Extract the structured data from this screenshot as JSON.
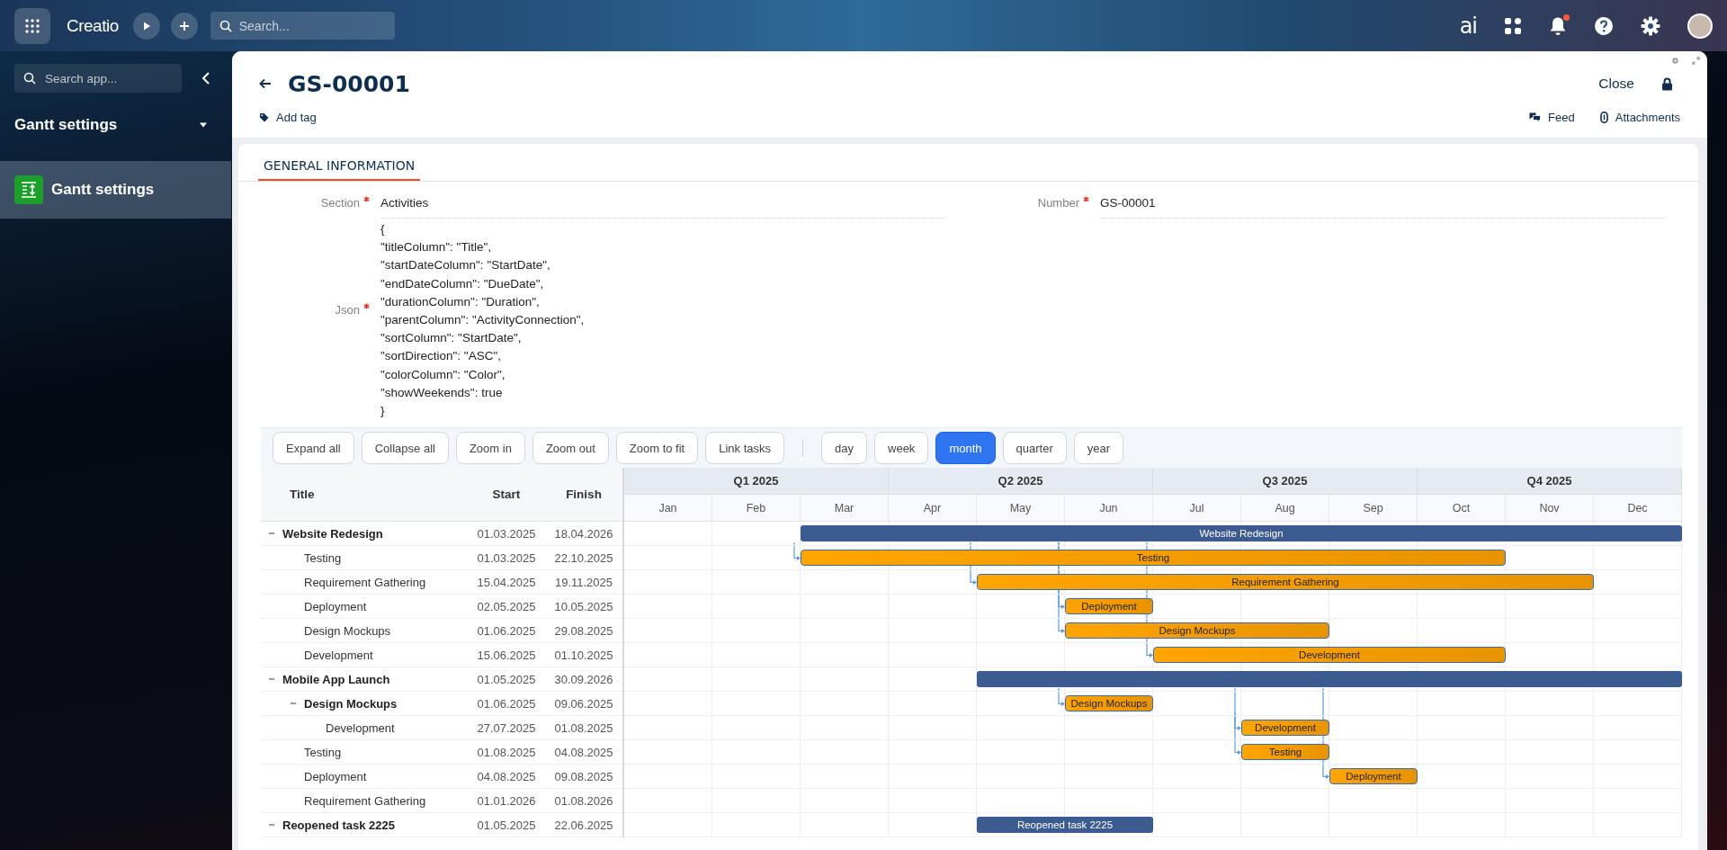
{
  "top_bar": {
    "logo": "Creatio",
    "search": {
      "placeholder": "Search..."
    },
    "ai_label": "ai",
    "notifications_unread": true
  },
  "sidebar": {
    "search": {
      "placeholder": "Search app..."
    },
    "section_title": "Gantt settings",
    "items": [
      {
        "label": "Gantt settings",
        "selected": true
      }
    ]
  },
  "record": {
    "title": "GS-00001",
    "close_label": "Close",
    "add_tag": "Add tag",
    "feed": "Feed",
    "attachments": "Attachments"
  },
  "tabs": [
    {
      "label": "GENERAL INFORMATION",
      "selected": true
    }
  ],
  "form_rows": [
    [
      {
        "label": "Section",
        "required": true,
        "value": "Activities"
      },
      {
        "label": "Number",
        "required": true,
        "value": "GS-00001"
      }
    ],
    [
      {
        "label": "Json",
        "required": true,
        "value": "{\n\"titleColumn\": \"Title\",\n\"startDateColumn\": \"StartDate\",\n\"endDateColumn\": \"DueDate\",\n\"durationColumn\": \"Duration\",\n\"parentColumn\": \"ActivityConnection\",\n\"sortColumn\": \"StartDate\",\n\"sortDirection\": \"ASC\",\n\"colorColumn\": \"Color\",\n\"showWeekends\": true\n}"
      }
    ]
  ],
  "gantt": {
    "actions": [
      "Expand all",
      "Collapse all",
      "Zoom in",
      "Zoom out",
      "Zoom to fit",
      "Link tasks"
    ],
    "scales": [
      {
        "label": "day",
        "selected": false
      },
      {
        "label": "week",
        "selected": false
      },
      {
        "label": "month",
        "selected": true
      },
      {
        "label": "quarter",
        "selected": false
      },
      {
        "label": "year",
        "selected": false
      }
    ],
    "columns": [
      "Title",
      "Start",
      "Finish"
    ],
    "quarters": [
      "Q1 2025",
      "Q2 2025",
      "Q3 2025",
      "Q4 2025"
    ],
    "months": [
      "Jan",
      "Feb",
      "Mar",
      "Apr",
      "May",
      "Jun",
      "Jul",
      "Aug",
      "Sep",
      "Oct",
      "Nov",
      "Dec"
    ],
    "rows": [
      {
        "title": "Website Redesign",
        "start": "01.03.2025",
        "finish": "18.04.2026",
        "kind": "summary",
        "expanded": true,
        "bar_label": "Website Redesign",
        "children": [
          {
            "title": "Testing",
            "start": "01.03.2025",
            "finish": "22.10.2025",
            "kind": "task",
            "bar_label": "Testing"
          },
          {
            "title": "Requirement Gathering",
            "start": "15.04.2025",
            "finish": "19.11.2025",
            "kind": "task",
            "bar_label": "Requirement Gathering"
          },
          {
            "title": "Deployment",
            "start": "02.05.2025",
            "finish": "10.05.2025",
            "kind": "task",
            "bar_label": "Deployment"
          },
          {
            "title": "Design Mockups",
            "start": "01.06.2025",
            "finish": "29.08.2025",
            "kind": "task",
            "bar_label": "Design Mockups"
          },
          {
            "title": "Development",
            "start": "15.06.2025",
            "finish": "01.10.2025",
            "kind": "task",
            "bar_label": "Development"
          }
        ]
      },
      {
        "title": "Mobile App Launch",
        "start": "01.05.2025",
        "finish": "30.09.2026",
        "kind": "summary",
        "expanded": true,
        "children": [
          {
            "title": "Design Mockups",
            "start": "01.06.2025",
            "finish": "09.06.2025",
            "kind": "task",
            "expanded": true,
            "bar_label": "Design Mockups",
            "children": [
              {
                "title": "Development",
                "start": "27.07.2025",
                "finish": "01.08.2025",
                "kind": "task",
                "bar_label": "Development"
              }
            ]
          },
          {
            "title": "Testing",
            "start": "01.08.2025",
            "finish": "04.08.2025",
            "kind": "task",
            "bar_label": "Testing"
          },
          {
            "title": "Deployment",
            "start": "04.08.2025",
            "finish": "09.08.2025",
            "kind": "task",
            "bar_label": "Deployment"
          },
          {
            "title": "Requirement Gathering",
            "start": "01.01.2026",
            "finish": "01.08.2026",
            "kind": "task"
          }
        ]
      },
      {
        "title": "Reopened task 2225",
        "start": "01.05.2025",
        "finish": "22.06.2025",
        "kind": "summary",
        "expanded": true,
        "bar_label": "Reopened task 2225"
      }
    ]
  }
}
